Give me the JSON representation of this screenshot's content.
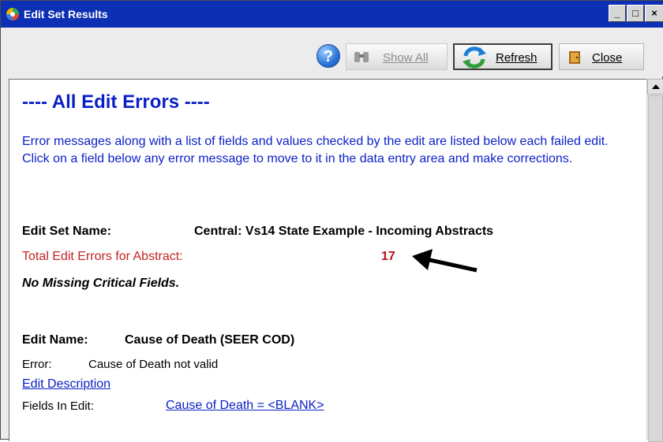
{
  "window": {
    "title": "Edit Set Results"
  },
  "toolbar": {
    "help_symbol": "?",
    "show_all_label": "Show All",
    "refresh_label": "Refresh",
    "close_label": "Close"
  },
  "report": {
    "heading": "---- All Edit Errors ----",
    "intro": "Error messages along with a list of fields and values checked by the edit are listed below each failed edit.  Click on a field below any error message to move to it in the data entry area and make corrections.",
    "edit_set_label": "Edit Set Name:",
    "edit_set_value": "Central: Vs14 State Example - Incoming Abstracts",
    "total_errors_label": "Total Edit Errors for Abstract:",
    "total_errors_value": "17",
    "missing_critical": "No Missing Critical Fields.",
    "edit": {
      "name_label": "Edit Name:",
      "name_value": "Cause of Death (SEER COD)",
      "error_label": "Error:",
      "error_value": "Cause of Death not valid",
      "description_link": "Edit Description",
      "fields_label": "Fields In Edit:",
      "field_link": "Cause of Death = <BLANK>"
    }
  },
  "colors": {
    "title_bar": "#0c2fb3",
    "link_blue": "#0b1fc7",
    "error_red": "#c22323"
  }
}
